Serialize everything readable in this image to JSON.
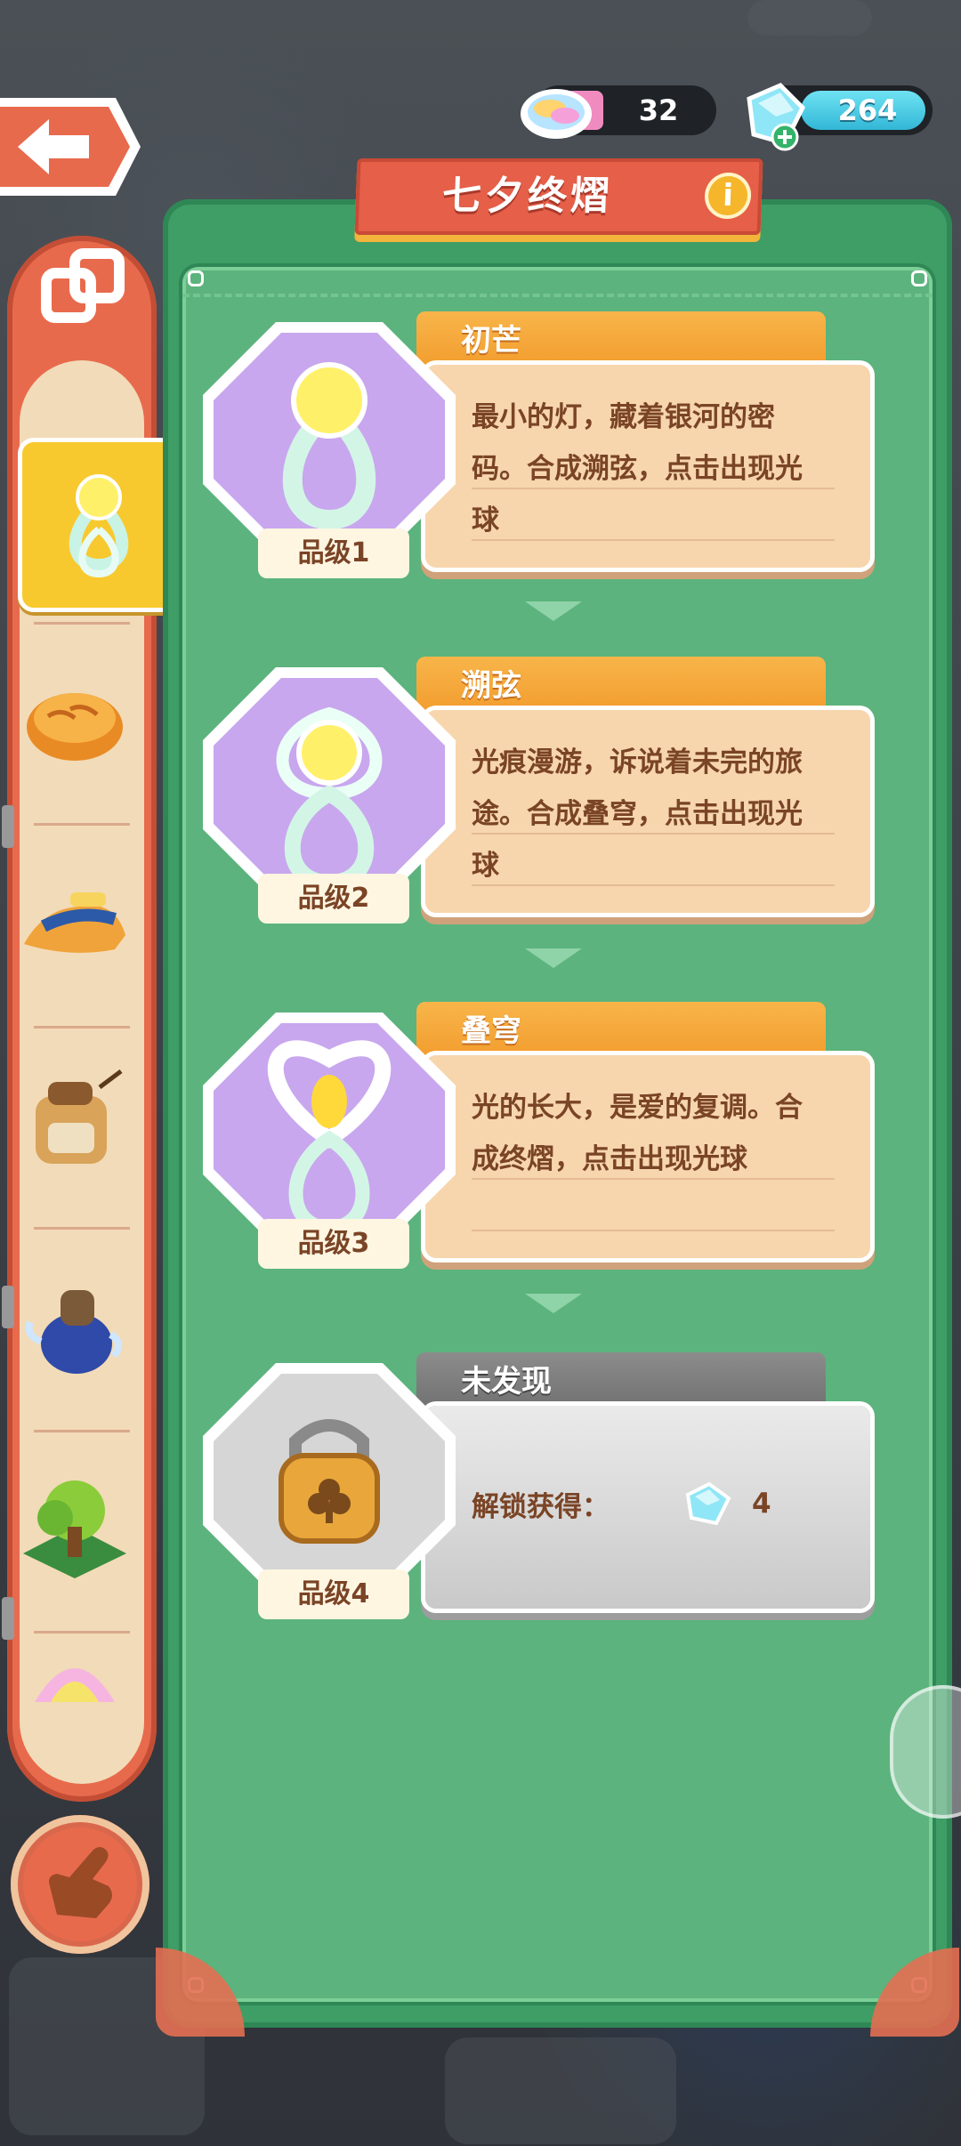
{
  "header": {
    "title": "七夕终熠",
    "info_label": "i",
    "currencies": [
      {
        "name": "rainbow-cloud",
        "value": "32"
      },
      {
        "name": "gem",
        "value": "264"
      }
    ]
  },
  "sidebar": {
    "tabs": [
      "infinity-orb-item",
      "bread-item",
      "shoe-item",
      "backpack-item",
      "teapot-item",
      "tree-item",
      "bubble-item"
    ],
    "active_index": 0
  },
  "cards": [
    {
      "name": "初芒",
      "desc": "最小的灯，藏着银河的密码。合成溯弦，点击出现光球",
      "grade": "品级1",
      "locked": false
    },
    {
      "name": "溯弦",
      "desc": "光痕漫游，诉说着未完的旅途。合成叠穹，点击出现光球",
      "grade": "品级2",
      "locked": false
    },
    {
      "name": "叠穹",
      "desc": "光的长大，是爱的复调。合成终熠，点击出现光球",
      "grade": "品级3",
      "locked": false
    },
    {
      "name": "未发现",
      "unlock_label": "解锁获得：",
      "unlock_value": "4",
      "unlock_icon": "gem-icon",
      "grade": "品级4",
      "locked": true
    }
  ],
  "colors": {
    "panel_green": "#3f9d66",
    "card_orange": "#f29a2b",
    "card_body": "#f7d6ae",
    "accent_red": "#e55f49",
    "text_brown": "#7a4426"
  }
}
